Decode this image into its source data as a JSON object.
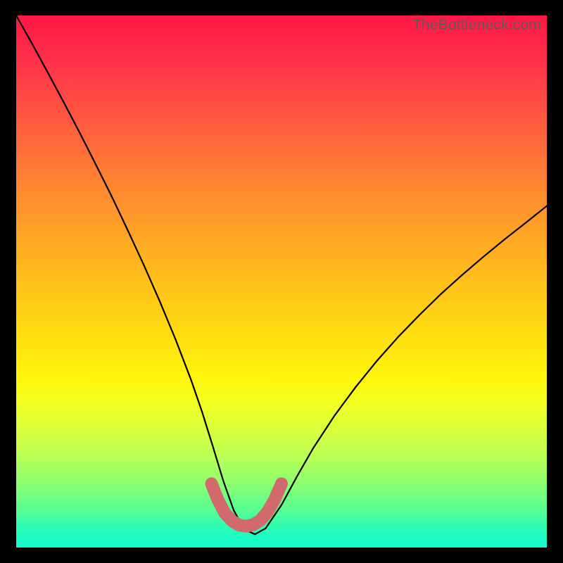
{
  "watermark": {
    "text": "TheBottleneck.com"
  },
  "chart_data": {
    "type": "line",
    "title": "",
    "xlabel": "",
    "ylabel": "",
    "xlim": [
      0,
      100
    ],
    "ylim": [
      0,
      100
    ],
    "grid": false,
    "legend": false,
    "series": [
      {
        "name": "curve",
        "color": "#000000",
        "x": [
          0,
          3,
          6,
          9,
          12,
          15,
          18,
          21,
          24,
          27,
          30,
          33,
          35,
          37,
          39,
          41,
          43,
          45,
          47,
          50,
          53,
          56,
          60,
          64,
          68,
          72,
          76,
          80,
          84,
          88,
          92,
          96,
          100
        ],
        "values": [
          100,
          94.7,
          89.2,
          83.6,
          77.9,
          72.0,
          66.0,
          59.7,
          53.2,
          46.4,
          39.2,
          31.4,
          25.6,
          19.2,
          12.6,
          7.0,
          3.4,
          2.5,
          3.6,
          8.0,
          13.5,
          18.7,
          24.8,
          30.2,
          35.1,
          39.6,
          43.7,
          47.6,
          51.2,
          54.6,
          57.9,
          61.0,
          64.2
        ]
      }
    ],
    "highlight": {
      "name": "optimal-range",
      "color": "#d16a6c",
      "x": [
        36.8,
        38.0,
        39.3,
        40.7,
        42.0,
        43.3,
        44.7,
        46.0,
        47.3,
        48.7,
        50.0
      ],
      "values": [
        12.0,
        9.0,
        6.5,
        5.0,
        4.2,
        4.0,
        4.3,
        5.1,
        6.6,
        9.0,
        12.0
      ]
    },
    "background_gradient": {
      "top": "#ff1646",
      "middle": "#fff50a",
      "bottom": "#0efad0"
    }
  }
}
